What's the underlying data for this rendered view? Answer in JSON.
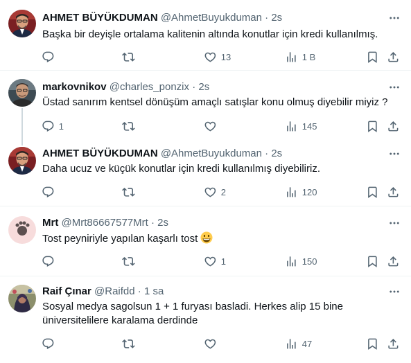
{
  "tweets": [
    {
      "name": "AHMET BÜYÜKDUMAN",
      "handle": "@AhmetBuyukduman",
      "time": "2s",
      "text": "Başka bir deyişle  ortalama kalitenin altında  konutlar için kredi kullanılmış.",
      "replies": "",
      "retweets": "",
      "likes": "13",
      "views": "1 B"
    },
    {
      "name": "markovnikov",
      "handle": "@charles_ponzix",
      "time": "2s",
      "text": "Üstad sanırım kentsel dönüşüm amaçlı satışlar konu olmuş diyebilir miyiz ?",
      "replies": "1",
      "retweets": "",
      "likes": "",
      "views": "145"
    },
    {
      "name": "AHMET BÜYÜKDUMAN",
      "handle": "@AhmetBuyukduman",
      "time": "2s",
      "text": "Daha ucuz ve küçük konutlar için kredi kullanılmış diyebiliriz.",
      "replies": "",
      "retweets": "",
      "likes": "2",
      "views": "120"
    },
    {
      "name": "Mrt",
      "handle": "@Mrt86667577Mrt",
      "time": "2s",
      "text": "Tost peyniriyle yapılan kaşarlı tost",
      "replies": "",
      "retweets": "",
      "likes": "1",
      "views": "150"
    },
    {
      "name": "Raif Çınar",
      "handle": "@Raifdd",
      "time": "1 sa",
      "text_line1": "Sosyal medya sagolsun 1 + 1 furyası basladi. Herkes alip 15 bine",
      "text_line2": "üniversitelilere karalama derdinde",
      "replies": "",
      "retweets": "",
      "likes": "",
      "views": "47"
    }
  ],
  "icons": {
    "reply": "reply-icon",
    "retweet": "retweet-icon",
    "like": "heart-icon",
    "views": "views-chart-icon",
    "bookmark": "bookmark-icon",
    "share": "share-icon",
    "more": "more-icon"
  },
  "dot": "·",
  "colors": {
    "secondary": "#536471",
    "separator": "#eff3f4",
    "thread": "#cfd9de"
  }
}
